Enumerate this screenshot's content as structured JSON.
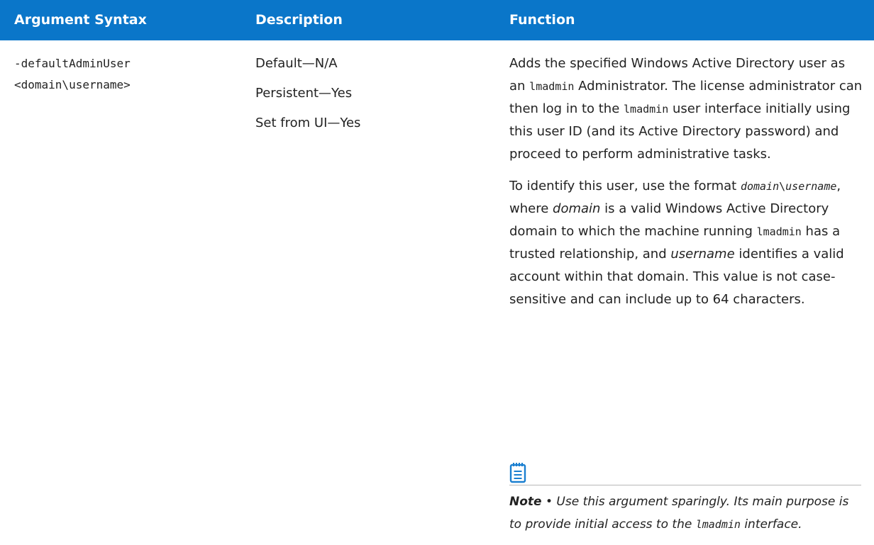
{
  "table": {
    "headers": {
      "argument_syntax": "Argument Syntax",
      "description": "Description",
      "function": "Function"
    },
    "row": {
      "syntax_line1": "-defaultAdminUser",
      "syntax_line2": "<domain\\username>",
      "description": {
        "default": "Default—N/A",
        "persistent": "Persistent—Yes",
        "set_from_ui": "Set from UI—Yes"
      },
      "function": {
        "p1_a": "Adds the specified Windows Active Directory user as an ",
        "p1_code1": "lmadmin",
        "p1_b": " Administrator. The license administrator can then log in to the ",
        "p1_code2": "lmadmin",
        "p1_c": " user interface initially using this user ID (and its Active Directory password) and proceed to perform administrative tasks.",
        "p2_a": "To identify this user, use the format ",
        "p2_code_domain": "domain",
        "p2_code_sep": "\\",
        "p2_code_username": "username",
        "p2_b": ", where ",
        "p2_ital_domain": "domain",
        "p2_c": " is a valid Windows Active Directory domain to which the machine running ",
        "p2_code_lmadmin": "lmadmin",
        "p2_d": " has a trusted relationship, and ",
        "p2_ital_username": "username",
        "p2_e": " identifies a valid account within that domain. This value is not case-sensitive and can include up to 64 characters."
      },
      "note": {
        "icon": "note-icon",
        "label": "Note",
        "bullet": " • ",
        "text_a": "Use this argument sparingly. Its main purpose is to provide initial access to the ",
        "code": "lmadmin",
        "text_b": " interface."
      }
    }
  },
  "colors": {
    "header_bg": "#0a76c9",
    "header_text": "#ffffff",
    "body_text": "#222222",
    "note_icon": "#1a7fd0"
  }
}
